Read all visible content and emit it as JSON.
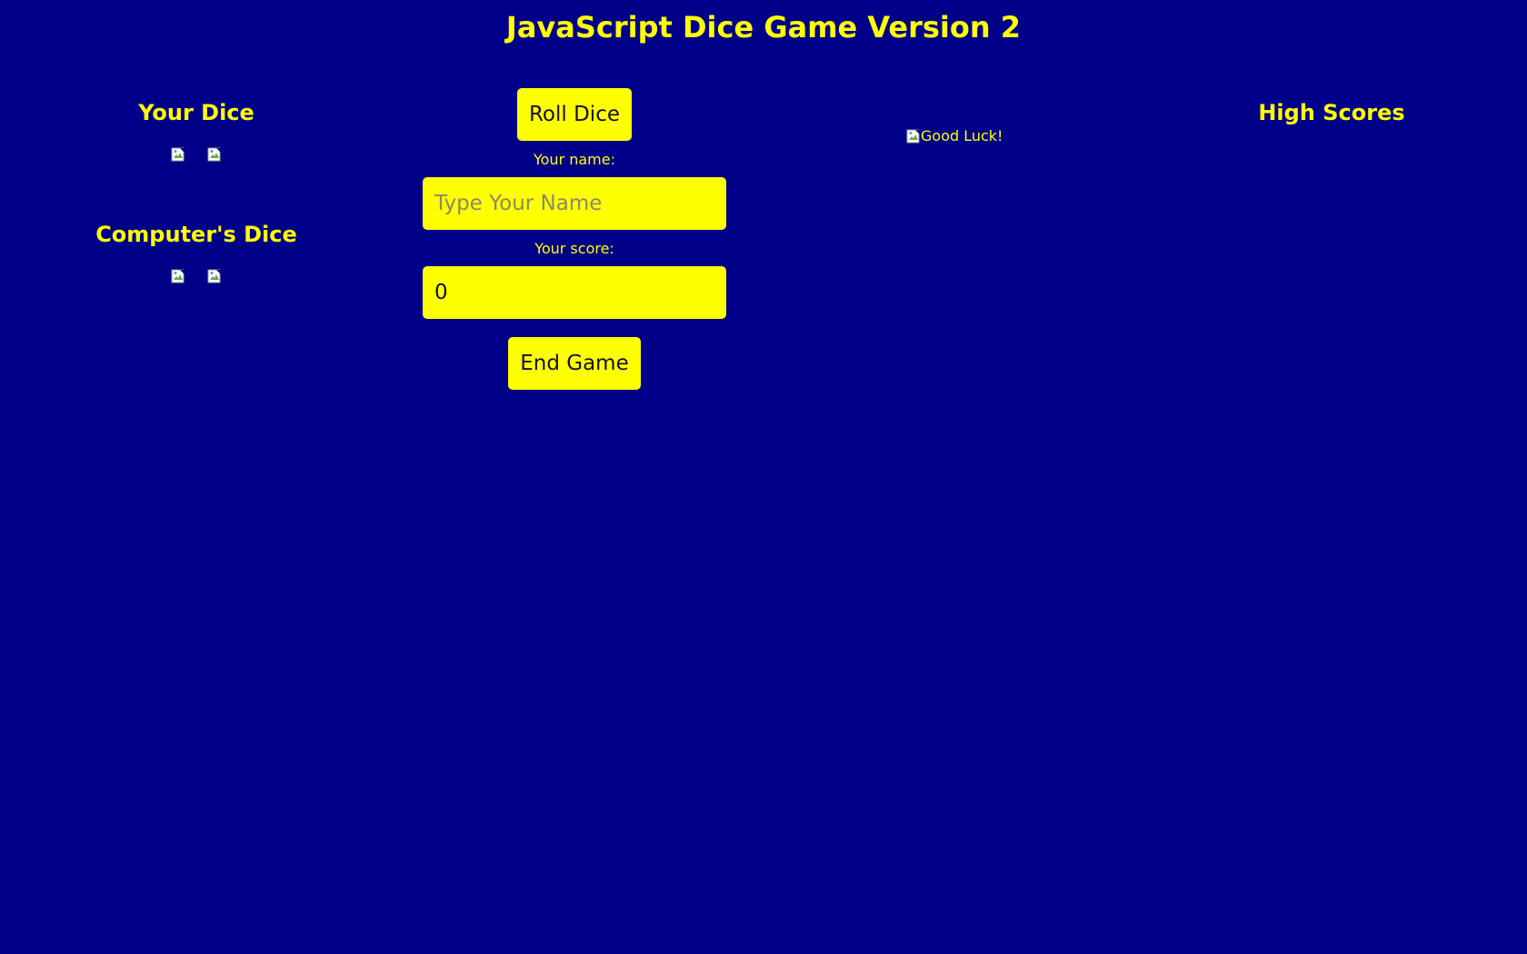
{
  "page": {
    "title": "JavaScript Dice Game Version 2",
    "background_color": "#000088",
    "accent_color": "#ffff00"
  },
  "left": {
    "your_dice_heading": "Your Dice",
    "computer_dice_heading": "Computer's Dice",
    "dice_icon": "broken-image-icon"
  },
  "center": {
    "roll_button": "Roll Dice",
    "name_label": "Your name:",
    "name_placeholder": "Type Your Name",
    "score_label": "Your score:",
    "score_value": "0",
    "end_button": "End Game"
  },
  "status": {
    "image_alt": "Good Luck!"
  },
  "right": {
    "high_scores_heading": "High Scores"
  }
}
